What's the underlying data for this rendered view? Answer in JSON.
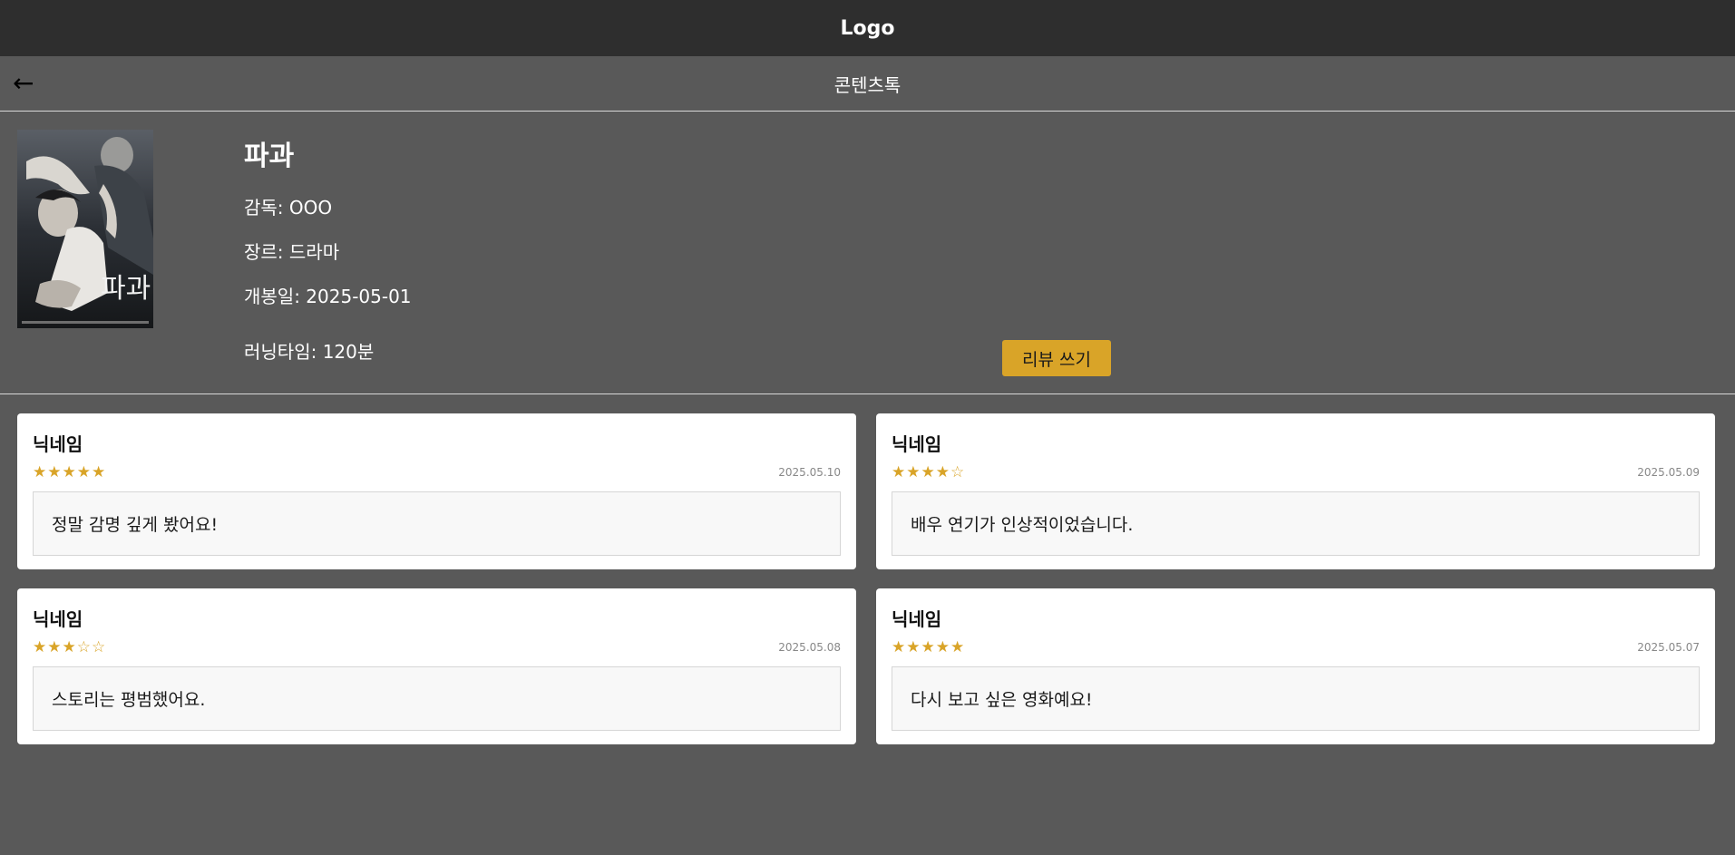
{
  "header": {
    "logo": "Logo"
  },
  "subheader": {
    "back": "←",
    "title": "콘텐츠톡"
  },
  "movie": {
    "title": "파과",
    "director": "감독: OOO",
    "genre": "장르: 드라마",
    "release": "개봉일: 2025-05-01",
    "runtime": "러닝타임: 120분",
    "poster_text": "파과",
    "review_button": "리뷰 쓰기"
  },
  "colors": {
    "accent": "#d9a428",
    "topbar": "#2e2e2e",
    "background": "#595959"
  },
  "reviews": [
    {
      "nickname": "닉네임",
      "rating": 5,
      "stars": "★★★★★",
      "date": "2025.05.10",
      "text": "정말 감명 깊게 봤어요!"
    },
    {
      "nickname": "닉네임",
      "rating": 4,
      "stars": "★★★★☆",
      "date": "2025.05.09",
      "text": "배우 연기가 인상적이었습니다."
    },
    {
      "nickname": "닉네임",
      "rating": 3,
      "stars": "★★★☆☆",
      "date": "2025.05.08",
      "text": "스토리는 평범했어요."
    },
    {
      "nickname": "닉네임",
      "rating": 5,
      "stars": "★★★★★",
      "date": "2025.05.07",
      "text": "다시 보고 싶은 영화예요!"
    }
  ]
}
